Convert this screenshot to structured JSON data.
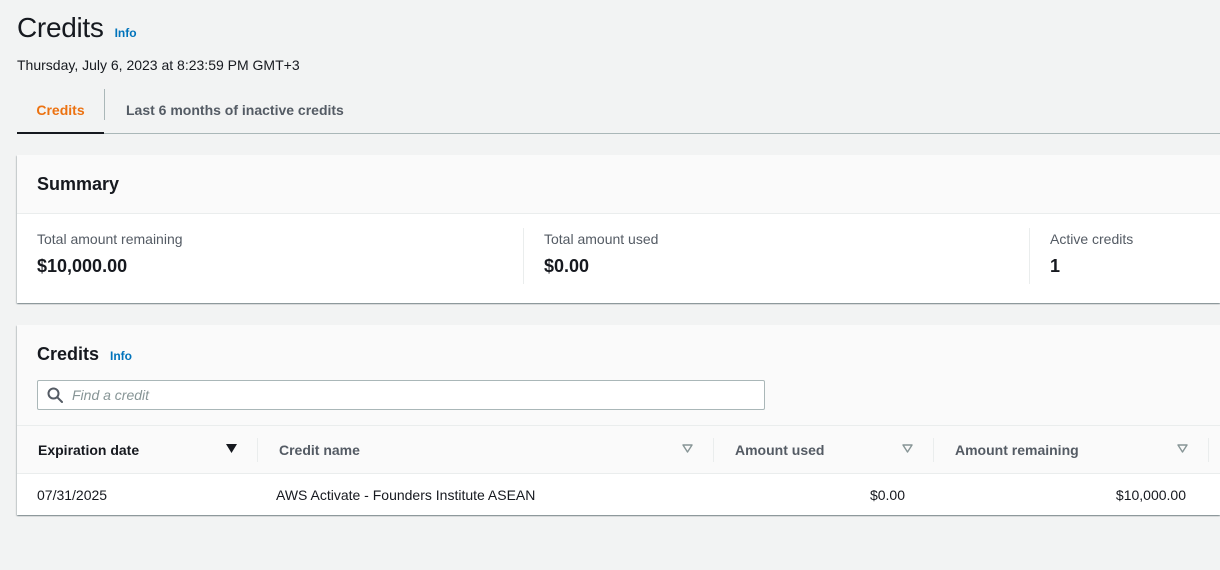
{
  "header": {
    "title": "Credits",
    "info_label": "Info",
    "timestamp": "Thursday, July 6, 2023 at 8:23:59 PM GMT+3"
  },
  "tabs": [
    {
      "label": "Credits",
      "active": true
    },
    {
      "label": "Last 6 months of inactive credits",
      "active": false
    }
  ],
  "summary": {
    "title": "Summary",
    "items": [
      {
        "label": "Total amount remaining",
        "value": "$10,000.00"
      },
      {
        "label": "Total amount used",
        "value": "$0.00"
      },
      {
        "label": "Active credits",
        "value": "1"
      }
    ]
  },
  "credits": {
    "title": "Credits",
    "info_label": "Info",
    "search": {
      "placeholder": "Find a credit",
      "value": ""
    },
    "columns": [
      {
        "label": "Expiration date",
        "sort": "descending"
      },
      {
        "label": "Credit name",
        "sort": "none"
      },
      {
        "label": "Amount used",
        "sort": "none"
      },
      {
        "label": "Amount remaining",
        "sort": "none"
      }
    ],
    "rows": [
      {
        "expiration_date": "07/31/2025",
        "credit_name": "AWS Activate - Founders Institute ASEAN",
        "amount_used": "$0.00",
        "amount_remaining": "$10,000.00"
      }
    ]
  },
  "colors": {
    "accent_tab": "#ec7211",
    "link": "#0073bb",
    "text": "#16191f",
    "muted": "#545b64"
  }
}
